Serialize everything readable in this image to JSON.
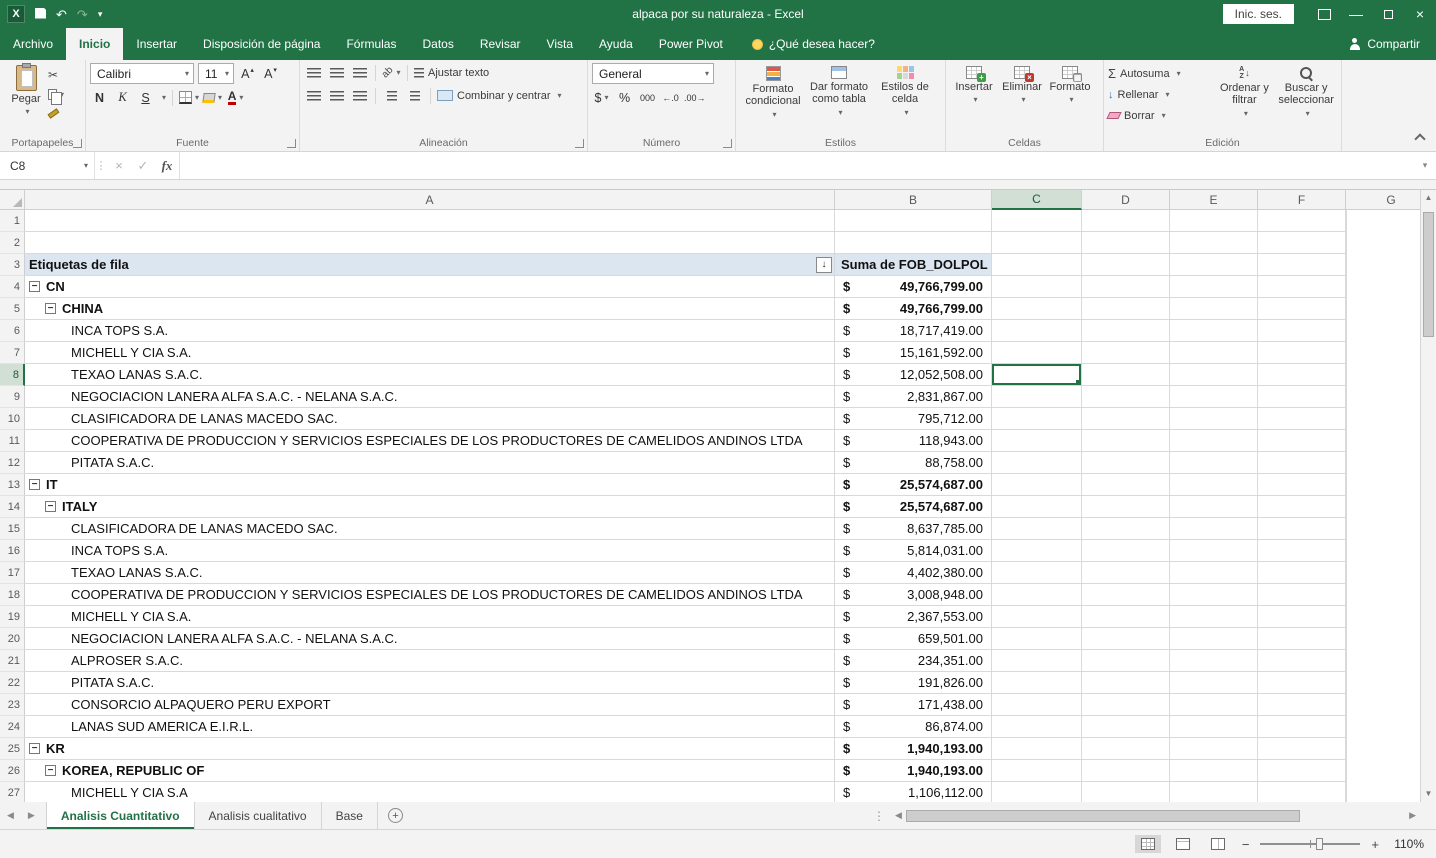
{
  "title_bar": {
    "title": "alpaca por su naturaleza  -  Excel",
    "sign_in": "Inic. ses."
  },
  "ribbon_tabs": [
    {
      "label": "Archivo"
    },
    {
      "label": "Inicio",
      "active": true
    },
    {
      "label": "Insertar"
    },
    {
      "label": "Disposición de página"
    },
    {
      "label": "Fórmulas"
    },
    {
      "label": "Datos"
    },
    {
      "label": "Revisar"
    },
    {
      "label": "Vista"
    },
    {
      "label": "Ayuda"
    },
    {
      "label": "Power Pivot"
    }
  ],
  "tell_me": "¿Qué desea hacer?",
  "share_label": "Compartir",
  "ribbon": {
    "clipboard": {
      "paste": "Pegar",
      "group_label": "Portapapeles"
    },
    "font": {
      "family": "Calibri",
      "size": "11",
      "bold": "N",
      "italic": "K",
      "underline": "S",
      "group_label": "Fuente"
    },
    "alignment": {
      "wrap_text": "Ajustar texto",
      "merge_center": "Combinar y centrar",
      "group_label": "Alineación"
    },
    "number": {
      "format": "General",
      "accounting": "$",
      "percent": "%",
      "thousands": "000",
      "group_label": "Número"
    },
    "styles": {
      "conditional": "Formato condicional",
      "format_table": "Dar formato como tabla",
      "cell_styles": "Estilos de celda",
      "group_label": "Estilos"
    },
    "cells": {
      "insert": "Insertar",
      "delete": "Eliminar",
      "format": "Formato",
      "group_label": "Celdas"
    },
    "editing": {
      "autosum": "Autosuma",
      "fill": "Rellenar",
      "clear": "Borrar",
      "sort": "Ordenar y filtrar",
      "find": "Buscar y seleccionar",
      "group_label": "Edición"
    }
  },
  "formula_bar": {
    "name_box": "C8",
    "fx": "fx",
    "formula": ""
  },
  "grid": {
    "column_headers": [
      "A",
      "B",
      "C",
      "D",
      "E",
      "F",
      "G"
    ],
    "selected_cell": "C8",
    "selected_column": "C",
    "selected_row": 8,
    "rows": [
      {
        "n": 1
      },
      {
        "n": 2
      },
      {
        "n": 3,
        "header": true,
        "label": "Etiquetas de fila",
        "value_label": "Suma de FOB_DOLPOL"
      },
      {
        "n": 4,
        "label": "CN",
        "level": 0,
        "collapse": true,
        "bold": true,
        "currency": "$",
        "value": "49,766,799.00"
      },
      {
        "n": 5,
        "label": "CHINA",
        "level": 1,
        "collapse": true,
        "bold": true,
        "currency": "$",
        "value": "49,766,799.00"
      },
      {
        "n": 6,
        "label": "INCA TOPS S.A.",
        "level": 2,
        "currency": "$",
        "value": "18,717,419.00"
      },
      {
        "n": 7,
        "label": "MICHELL Y CIA S.A.",
        "level": 2,
        "currency": "$",
        "value": "15,161,592.00"
      },
      {
        "n": 8,
        "label": "TEXAO LANAS S.A.C.",
        "level": 2,
        "currency": "$",
        "value": "12,052,508.00"
      },
      {
        "n": 9,
        "label": "NEGOCIACION LANERA ALFA S.A.C. - NELANA S.A.C.",
        "level": 2,
        "currency": "$",
        "value": "2,831,867.00"
      },
      {
        "n": 10,
        "label": "CLASIFICADORA DE LANAS MACEDO SAC.",
        "level": 2,
        "currency": "$",
        "value": "795,712.00"
      },
      {
        "n": 11,
        "label": "COOPERATIVA DE PRODUCCION Y SERVICIOS ESPECIALES DE LOS PRODUCTORES DE CAMELIDOS ANDINOS LTDA",
        "level": 2,
        "currency": "$",
        "value": "118,943.00"
      },
      {
        "n": 12,
        "label": "PITATA S.A.C.",
        "level": 2,
        "currency": "$",
        "value": "88,758.00"
      },
      {
        "n": 13,
        "label": "IT",
        "level": 0,
        "collapse": true,
        "bold": true,
        "currency": "$",
        "value": "25,574,687.00"
      },
      {
        "n": 14,
        "label": "ITALY",
        "level": 1,
        "collapse": true,
        "bold": true,
        "currency": "$",
        "value": "25,574,687.00"
      },
      {
        "n": 15,
        "label": "CLASIFICADORA DE LANAS MACEDO SAC.",
        "level": 2,
        "currency": "$",
        "value": "8,637,785.00"
      },
      {
        "n": 16,
        "label": "INCA TOPS S.A.",
        "level": 2,
        "currency": "$",
        "value": "5,814,031.00"
      },
      {
        "n": 17,
        "label": "TEXAO LANAS S.A.C.",
        "level": 2,
        "currency": "$",
        "value": "4,402,380.00"
      },
      {
        "n": 18,
        "label": "COOPERATIVA DE PRODUCCION Y SERVICIOS ESPECIALES DE LOS PRODUCTORES DE CAMELIDOS ANDINOS LTDA",
        "level": 2,
        "currency": "$",
        "value": "3,008,948.00"
      },
      {
        "n": 19,
        "label": "MICHELL Y CIA S.A.",
        "level": 2,
        "currency": "$",
        "value": "2,367,553.00"
      },
      {
        "n": 20,
        "label": "NEGOCIACION LANERA ALFA S.A.C. - NELANA S.A.C.",
        "level": 2,
        "currency": "$",
        "value": "659,501.00"
      },
      {
        "n": 21,
        "label": "ALPROSER S.A.C.",
        "level": 2,
        "currency": "$",
        "value": "234,351.00"
      },
      {
        "n": 22,
        "label": "PITATA S.A.C.",
        "level": 2,
        "currency": "$",
        "value": "191,826.00"
      },
      {
        "n": 23,
        "label": "CONSORCIO ALPAQUERO PERU EXPORT",
        "level": 2,
        "currency": "$",
        "value": "171,438.00"
      },
      {
        "n": 24,
        "label": "LANAS SUD AMERICA E.I.R.L.",
        "level": 2,
        "currency": "$",
        "value": "86,874.00"
      },
      {
        "n": 25,
        "label": "KR",
        "level": 0,
        "collapse": true,
        "bold": true,
        "currency": "$",
        "value": "1,940,193.00"
      },
      {
        "n": 26,
        "label": "KOREA, REPUBLIC OF",
        "level": 1,
        "collapse": true,
        "bold": true,
        "currency": "$",
        "value": "1,940,193.00"
      },
      {
        "n": 27,
        "label": "MICHELL Y CIA S.A",
        "level": 2,
        "currency": "$",
        "value": "1,106,112.00"
      }
    ]
  },
  "sheet_tabs": [
    {
      "label": "Analisis Cuantitativo",
      "active": true
    },
    {
      "label": "Analisis cualitativo"
    },
    {
      "label": "Base"
    }
  ],
  "status_bar": {
    "zoom": "110%"
  },
  "colors": {
    "accent": "#217346",
    "pivot_header_bg": "#dce6f1",
    "selection": "#217346"
  }
}
